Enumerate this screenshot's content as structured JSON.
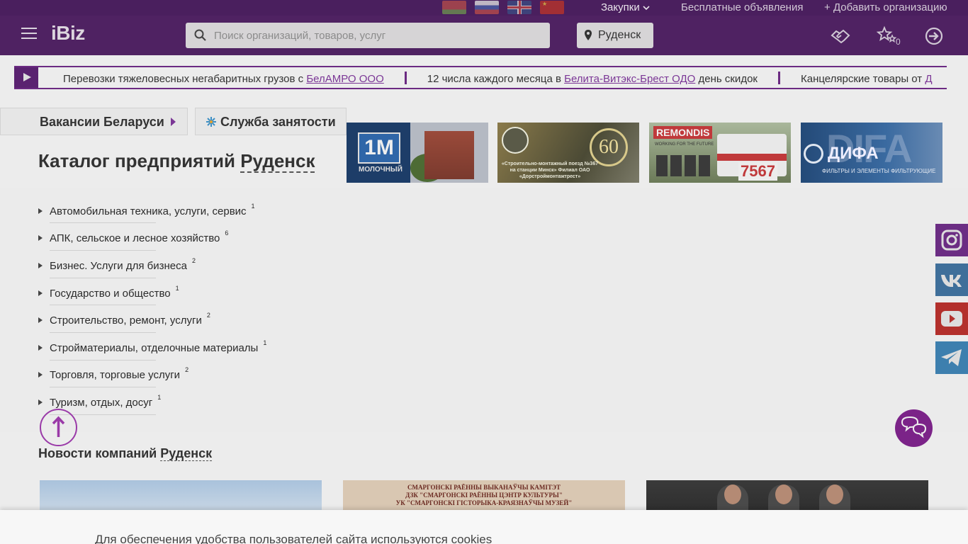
{
  "topbar": {
    "flags": [
      "by",
      "ru",
      "uk",
      "cn"
    ],
    "zakupki": "Закупки",
    "free_ads": "Бесплатные объявления",
    "add_org": "Добавить организацию"
  },
  "header": {
    "logo": "iBiz",
    "search_placeholder": "Поиск организаций, товаров, услуг",
    "city": "Руденск",
    "favorites_count": "0"
  },
  "ticker": {
    "items": [
      {
        "pre": "Перевозки тяжеловесных негабаритных грузов с ",
        "link": "БелАМРО ООО",
        "post": ""
      },
      {
        "pre": "12 числа каждого месяца в ",
        "link": "Белита-Витэкс-Брест ОДО",
        "post": " день скидок"
      },
      {
        "pre": "Канцелярские товары от ",
        "link": "Д",
        "post": ""
      }
    ]
  },
  "vacancies_label": "Вакансии Беларуси",
  "employment_label": "Служба занятости",
  "catalog": {
    "title_prefix": "Каталог предприятий",
    "city": "Руденск",
    "items": [
      {
        "label": "Автомобильная техника, услуги, сервис",
        "count": "1"
      },
      {
        "label": "АПК, сельское и лесное хозяйство",
        "count": "6"
      },
      {
        "label": "Бизнес. Услуги для бизнеса",
        "count": "2"
      },
      {
        "label": "Государство и общество",
        "count": "1"
      },
      {
        "label": "Строительство, ремонт, услуги",
        "count": "2"
      },
      {
        "label": "Стройматериалы, отделочные материалы",
        "count": "1"
      },
      {
        "label": "Торговля, торговые услуги",
        "count": "2"
      },
      {
        "label": "Туризм, отдых, досуг",
        "count": "1"
      }
    ]
  },
  "banners": {
    "b1": {
      "logo": "1M",
      "sub": "МОЛОЧНЫЙ"
    },
    "b2": {
      "badge": "60",
      "text": "«Строительно-монтажный поезд №367 на станции Минск» Филиал ОАО «Дорстроймонтажтрест»"
    },
    "b3": {
      "brand": "REMONDIS",
      "tag": "WORKING FOR THE FUTURE",
      "number": "7567"
    },
    "b4": {
      "big": "DIFA",
      "name": "ДИФА",
      "sub": "ФИЛЬТРЫ И ЭЛЕМЕНТЫ ФИЛЬТРУЮЩИЕ"
    }
  },
  "news": {
    "title_prefix": "Новости компаний",
    "city": "Руденск",
    "img2_lines": [
      "СМАРГОНСКІ РАЁННЫ ВЫКАНАЎЧЫ КАМІТЭТ",
      "ДЗК \"СМАРГОНСКІ РАЁННЫ ЦЭНТР КУЛЬТУРЫ\"",
      "УК \"СМАРГОНСКІ ГІСТОРЫКА-КРАЯЗНАЎЧЫ МУЗЕЙ\""
    ]
  },
  "cookie": {
    "text": "Для обеспечения удобства пользователей сайта используются cookies"
  },
  "colors": {
    "brand": "#4f2262",
    "accent": "#7b3796"
  }
}
